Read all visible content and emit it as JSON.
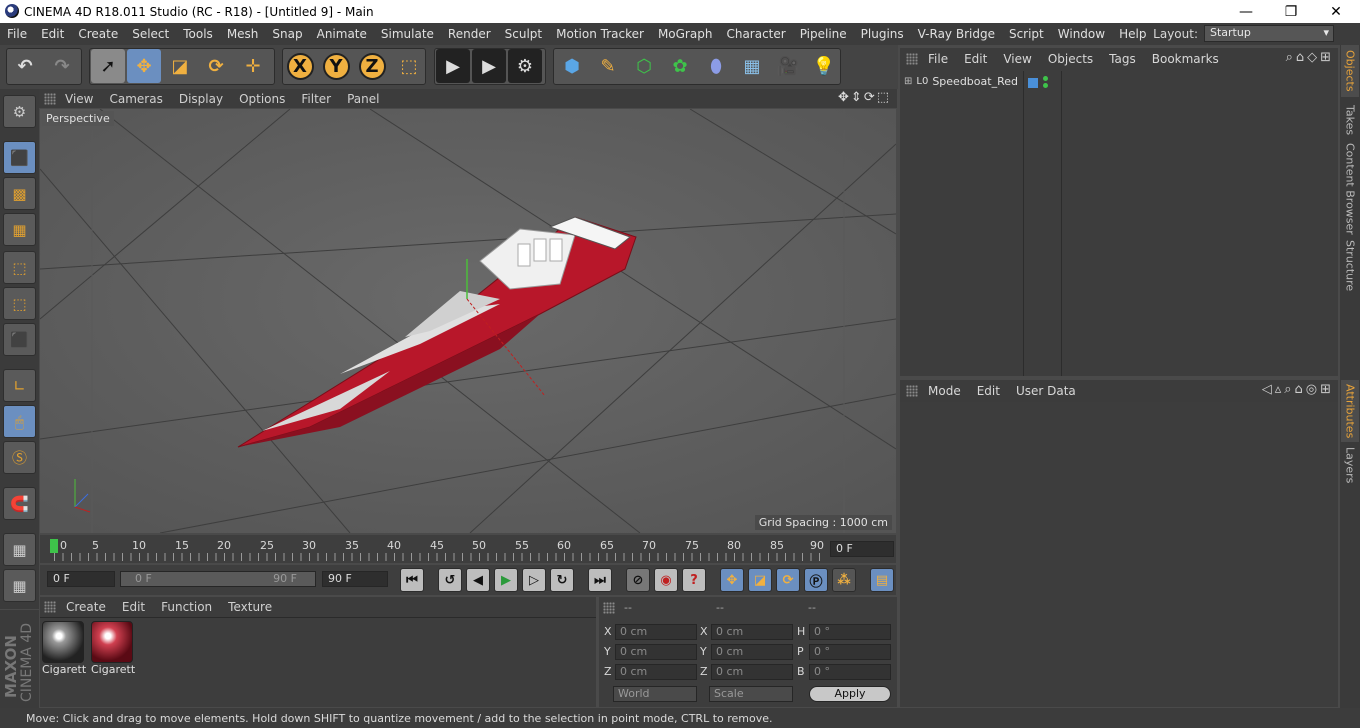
{
  "window": {
    "title": "CINEMA 4D R18.011 Studio (RC - R18) - [Untitled 9] - Main",
    "minimize": "—",
    "maximize": "❐",
    "close": "✕"
  },
  "menubar": {
    "items": [
      "File",
      "Edit",
      "Create",
      "Select",
      "Tools",
      "Mesh",
      "Snap",
      "Animate",
      "Simulate",
      "Render",
      "Sculpt",
      "Motion Tracker",
      "MoGraph",
      "Character",
      "Pipeline",
      "Plugins",
      "V-Ray Bridge",
      "Script",
      "Window",
      "Help"
    ],
    "layout_label": "Layout:",
    "layout_value": "Startup"
  },
  "toolbar": {
    "axis_x": "X",
    "axis_y": "Y",
    "axis_z": "Z"
  },
  "viewport": {
    "menu": [
      "View",
      "Cameras",
      "Display",
      "Options",
      "Filter",
      "Panel"
    ],
    "label": "Perspective",
    "grid_spacing": "Grid Spacing : 1000 cm"
  },
  "timeline": {
    "ticks": [
      "0",
      "5",
      "10",
      "15",
      "20",
      "25",
      "30",
      "35",
      "40",
      "45",
      "50",
      "55",
      "60",
      "65",
      "70",
      "75",
      "80",
      "85",
      "90"
    ],
    "current_frame": "0 F"
  },
  "playback": {
    "start": "0 F",
    "range_start": "0 F",
    "range_end": "90 F",
    "end": "90 F"
  },
  "materials": {
    "menu": [
      "Create",
      "Edit",
      "Function",
      "Texture"
    ],
    "items": [
      {
        "name": "Cigarett"
      },
      {
        "name": "Cigarett"
      }
    ]
  },
  "coordinates": {
    "headers": [
      "--",
      "--",
      "--"
    ],
    "rows": [
      {
        "a": "X",
        "av": "0 cm",
        "b": "X",
        "bv": "0 cm",
        "c": "H",
        "cv": "0 °"
      },
      {
        "a": "Y",
        "av": "0 cm",
        "b": "Y",
        "bv": "0 cm",
        "c": "P",
        "cv": "0 °"
      },
      {
        "a": "Z",
        "av": "0 cm",
        "b": "Z",
        "bv": "0 cm",
        "c": "B",
        "cv": "0 °"
      }
    ],
    "world": "World",
    "scale": "Scale",
    "apply": "Apply"
  },
  "objects": {
    "menu": [
      "File",
      "Edit",
      "View",
      "Objects",
      "Tags",
      "Bookmarks"
    ],
    "items": [
      {
        "name": "Speedboat_Red"
      }
    ]
  },
  "attributes": {
    "menu": [
      "Mode",
      "Edit",
      "User Data"
    ]
  },
  "side_tabs": [
    "Objects",
    "Takes",
    "Content Browser",
    "Structure"
  ],
  "side_tabs_lower": [
    "Attributes",
    "Layers"
  ],
  "brand": {
    "maxon": "MAXON",
    "product": "CINEMA 4D"
  },
  "status": "Move: Click and drag to move elements. Hold down SHIFT to quantize movement / add to the selection in point mode, CTRL to remove.",
  "colors": {
    "accent": "#e8a33a",
    "selected_blue": "#4a90d9",
    "boat_red": "#c8182a"
  }
}
